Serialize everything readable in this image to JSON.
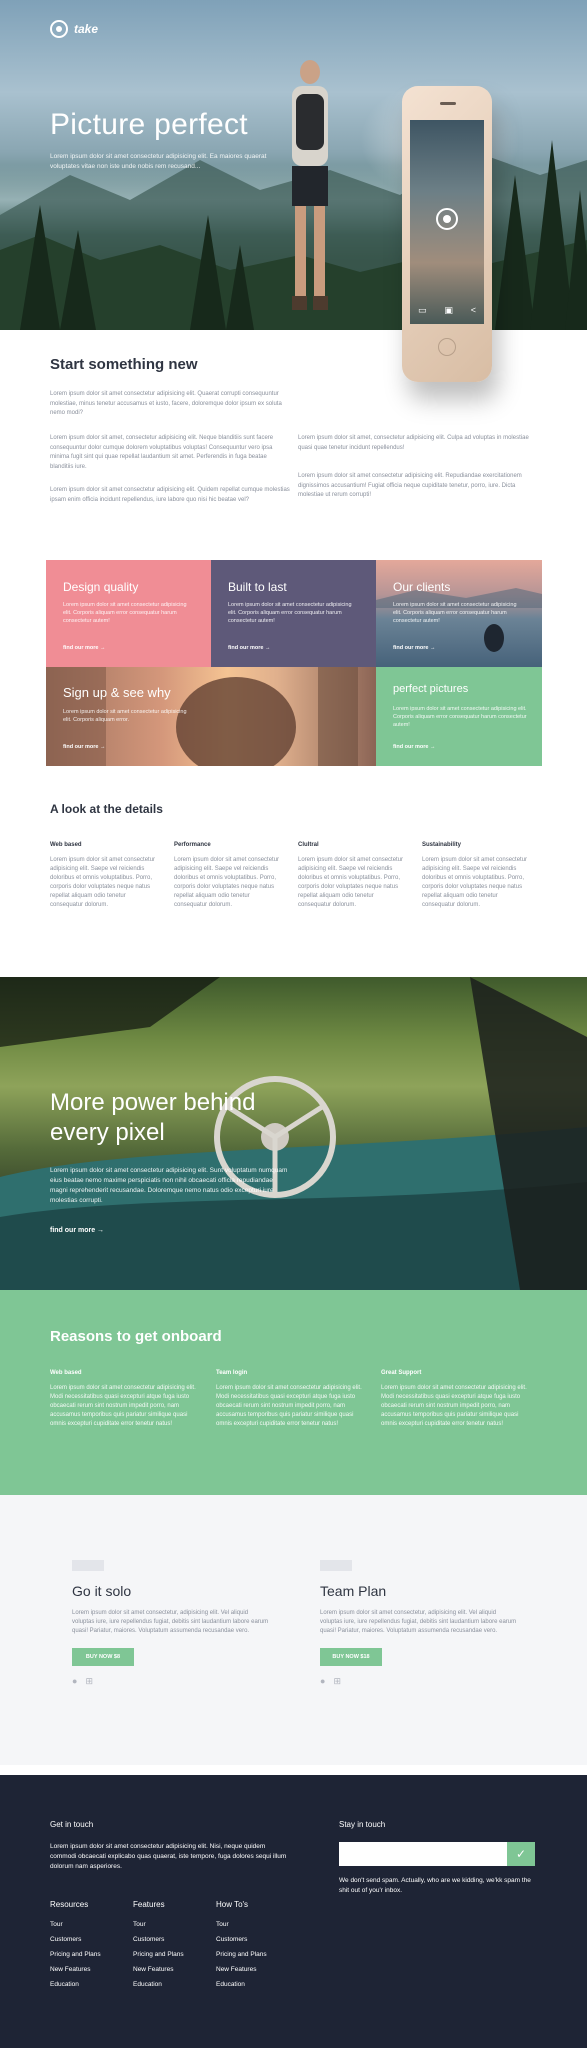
{
  "hero": {
    "brand": "take",
    "title": "Picture perfect",
    "subtitle": "Lorem ipsum dolor sit amet consectetur adipisicing elit. Ea maiores quaerat voluptates vitae non iste unde nobis rem recusand..."
  },
  "intro": {
    "title": "Start something new",
    "p1": "Lorem ipsum dolor sit amet consectetur adipisicing elit. Quaerat corrupti consequuntur molestiae, minus tenetur accusamus et iusto, facere, doloremque dolor ipsum ex soluta nemo modi?",
    "p2": "Lorem ipsum dolor sit amet, consectetur adipisicing elit. Neque blanditiis sunt facere consequuntur dolor cumque dolorem voluptatibus voluptas! Consequuntur vero ipsa minima fugit sint qui quae repellat laudantium sit amet. Perferendis in fuga beatae blanditiis iure.",
    "p3": "Lorem ipsum dolor sit amet consectetur adipisicing elit. Quidem repellat cumque molestias ipsam enim officia incidunt repellendus, iure labore quo nisi hic beatae vel?",
    "p4": "Lorem ipsum dolor sit amet, consectetur adipisicing elit. Culpa ad voluptas in molestiae quasi quae tenetur incidunt repellendus!",
    "p5": "Lorem ipsum dolor sit amet consectetur adipisicing elit. Repudiandae exercitationem dignissimos accusantium! Fugiat officia neque cupiditate tenetur, porro, iure. Dicta molestiae ut rerum corrupti!"
  },
  "tiles": [
    {
      "title": "Design quality",
      "body": "Lorem ipsum dolor sit amet consectetur adipisicing elit. Corporis aliquam error consequatur harum consectetur autem!",
      "link": "find our more →"
    },
    {
      "title": "Built to last",
      "body": "Lorem ipsum dolor sit amet consectetur adipisicing elit. Corporis aliquam error consequatur harum consectetur autem!",
      "link": "find our more →"
    },
    {
      "title": "Our clients",
      "body": "Lorem ipsum dolor sit amet consectetur adipisicing elit. Corporis aliquam error consequatur harum consectetur autem!",
      "link": "find our more →"
    },
    {
      "title": "Sign up & see why",
      "body": "Lorem ipsum dolor sit amet consectetur adipisicing elit. Corporis aliquam error.",
      "link": "find our more →"
    },
    {
      "title": "perfect pictures",
      "body": "Lorem ipsum dolor sit amet consectetur adipisicing elit. Corporis aliquam error consequatur harum consectetur autem!",
      "link": "find our more →"
    }
  ],
  "details": {
    "title": "A look at the details",
    "items": [
      {
        "heading": "Web based",
        "body": "Lorem ipsum dolor sit amet consectetur adipisicing elit. Saepe vel reiciendis doloribus et omnis voluptatibus. Porro, corporis dolor voluptates neque natus repellat aliquam odio tenetur consequatur dolorum."
      },
      {
        "heading": "Performance",
        "body": "Lorem ipsum dolor sit amet consectetur adipisicing elit. Saepe vel reiciendis doloribus et omnis voluptatibus. Porro, corporis dolor voluptates neque natus repellat aliquam odio tenetur consequatur dolorum."
      },
      {
        "heading": "Clultral",
        "body": "Lorem ipsum dolor sit amet consectetur adipisicing elit. Saepe vel reiciendis doloribus et omnis voluptatibus. Porro, corporis dolor voluptates neque natus repellat aliquam odio tenetur consequatur dolorum."
      },
      {
        "heading": "Sustainability",
        "body": "Lorem ipsum dolor sit amet consectetur adipisicing elit. Saepe vel reiciendis doloribus et omnis voluptatibus. Porro, corporis dolor voluptates neque natus repellat aliquam odio tenetur consequatur dolorum."
      }
    ]
  },
  "power": {
    "title": "More power behind every pixel",
    "body": "Lorem ipsum dolor sit amet consectetur adipisicing elit. Sunt voluptatum numquam eius beatae nemo maxime perspiciatis non nihil obcaecati officia repudiandae magni reprehenderit recusandae. Doloremque nemo natus odio excepturi iure molestias corrupti.",
    "link": "find our more →"
  },
  "reasons": {
    "title": "Reasons to get onboard",
    "items": [
      {
        "heading": "Web based",
        "body": "Lorem ipsum dolor sit amet consectetur adipisicing elit. Modi necessitatibus quasi excepturi atque fuga iusto obcaecati rerum sint nostrum impedit porro, nam accusamus temporibus quis pariatur similique quasi omnis excepturi cupiditate error tenetur natus!"
      },
      {
        "heading": "Team login",
        "body": "Lorem ipsum dolor sit amet consectetur adipisicing elit. Modi necessitatibus quasi excepturi atque fuga iusto obcaecati rerum sint nostrum impedit porro, nam accusamus temporibus quis pariatur similique quasi omnis excepturi cupiditate error tenetur natus!"
      },
      {
        "heading": "Great Support",
        "body": "Lorem ipsum dolor sit amet consectetur adipisicing elit. Modi necessitatibus quasi excepturi atque fuga iusto obcaecati rerum sint nostrum impedit porro, nam accusamus temporibus quis pariatur similique quasi omnis excepturi cupiditate error tenetur natus!"
      }
    ]
  },
  "plans": [
    {
      "title": "Go it solo",
      "body": "Lorem ipsum dolor sit amet consectetur, adipisicing elit. Vel aliquid voluptas iure, iure repellendus fugiat, debitis sint laudantium labore earum quasi! Pariatur, maiores. Voluptatum assumenda recusandae vero.",
      "button": "BUY NOW $8"
    },
    {
      "title": "Team Plan",
      "body": "Lorem ipsum dolor sit amet consectetur, adipisicing elit. Vel aliquid voluptas iure, iure repellendus fugiat, debitis sint laudantium labore earum quasi! Pariatur, maiores. Voluptatum assumenda recusandae vero.",
      "button": "BUY NOW $18"
    }
  ],
  "footer": {
    "contact_heading": "Get in touch",
    "contact_text": "Lorem ipsum dolor sit amet consectetur adipisicing elit. Nisi, neque quidem commodi obcaecati explicabo quas quaerat, iste tempore, fuga dolores sequi illum dolorum nam asperiores.",
    "stay_heading": "Stay in touch",
    "spam_note": "We don't send spam. Actually, who are we kidding, we'kk spam the shit out of you'r inbox.",
    "columns": [
      {
        "heading": "Resources",
        "links": [
          "Tour",
          "Customers",
          "Pricing and Plans",
          "New Features",
          "Education"
        ]
      },
      {
        "heading": "Features",
        "links": [
          "Tour",
          "Customers",
          "Pricing and Plans",
          "New Features",
          "Education"
        ]
      },
      {
        "heading": "How To's",
        "links": [
          "Tour",
          "Customers",
          "Pricing and Plans",
          "New Features",
          "Education"
        ]
      }
    ]
  },
  "colors": {
    "green": "#7fc695",
    "pink": "#f08d95",
    "purple": "#5e5979",
    "navy": "#1e2435"
  }
}
